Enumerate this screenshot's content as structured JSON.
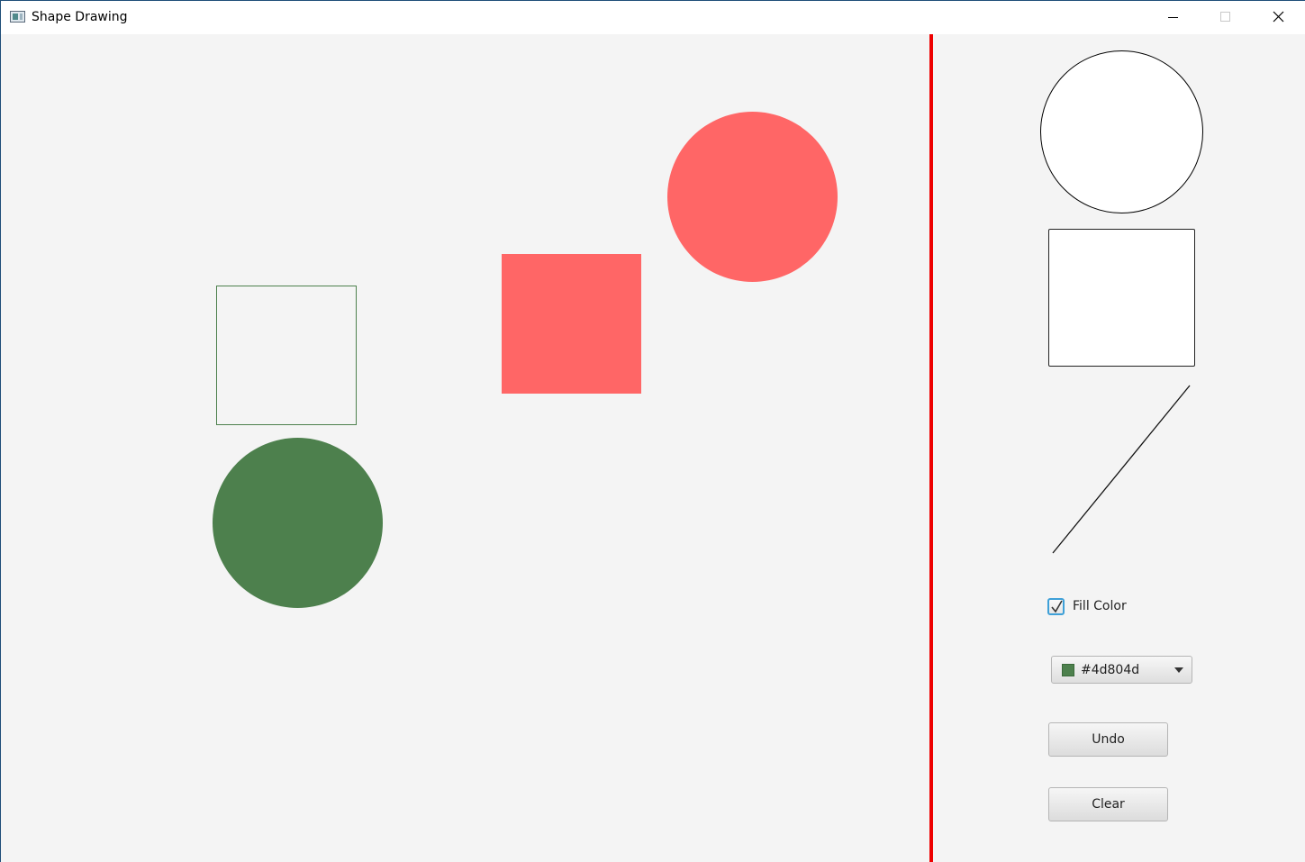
{
  "window": {
    "title": "Shape Drawing",
    "app_icon": "window-app-icon",
    "controls": {
      "minimize_icon": "minimize-icon",
      "maximize_icon": "maximize-icon",
      "close_icon": "close-icon"
    }
  },
  "colors": {
    "canvas_background": "#f4f4f4",
    "divider": "#ee0000",
    "green": "#4d804d",
    "red": "#ff6666"
  },
  "canvas": {
    "shapes": [
      {
        "kind": "rectangle",
        "filled": false,
        "color": "#4d804d"
      },
      {
        "kind": "rectangle",
        "filled": true,
        "color": "#ff6666"
      },
      {
        "kind": "circle",
        "filled": true,
        "color": "#ff6666"
      },
      {
        "kind": "circle",
        "filled": true,
        "color": "#4d804d"
      }
    ]
  },
  "palette": {
    "tools": [
      "circle",
      "rectangle",
      "line"
    ]
  },
  "controls": {
    "fill_color": {
      "label": "Fill Color",
      "checked": true
    },
    "color_picker": {
      "value": "#4d804d",
      "swatch_color": "#4d804d"
    },
    "undo_label": "Undo",
    "clear_label": "Clear"
  }
}
